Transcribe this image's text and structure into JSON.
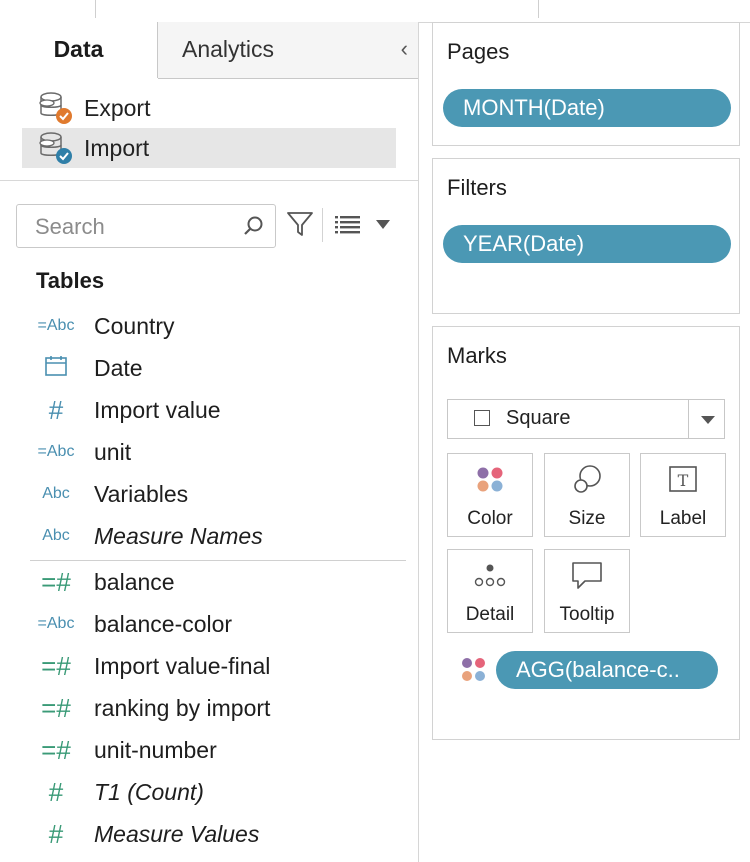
{
  "tabs": {
    "data": "Data",
    "analytics": "Analytics",
    "collapse_glyph": "‹"
  },
  "data_sources": [
    {
      "name": "Export",
      "icon": "database-export-icon",
      "badge_color": "#e07a2e",
      "selected": false
    },
    {
      "name": "Import",
      "icon": "database-import-icon",
      "badge_color": "#2f7fa8",
      "selected": true
    }
  ],
  "search": {
    "placeholder": "Search",
    "value": ""
  },
  "tables_header": "Tables",
  "dimensions": [
    {
      "name": "Country",
      "icon": "=Abc",
      "icon_name": "calculated-string-icon",
      "italic": false
    },
    {
      "name": "Date",
      "icon": "calendar",
      "icon_name": "calendar-icon",
      "italic": false
    },
    {
      "name": "Import value",
      "icon": "#",
      "icon_name": "number-icon",
      "italic": false
    },
    {
      "name": "unit",
      "icon": "=Abc",
      "icon_name": "calculated-string-icon",
      "italic": false
    },
    {
      "name": "Variables",
      "icon": "Abc",
      "icon_name": "string-icon",
      "italic": false
    },
    {
      "name": "Measure Names",
      "icon": "Abc",
      "icon_name": "string-icon",
      "italic": true
    }
  ],
  "measures": [
    {
      "name": "balance",
      "icon": "=#",
      "icon_name": "calculated-number-icon",
      "italic": false
    },
    {
      "name": "balance-color",
      "icon": "=Abc",
      "icon_name": "calculated-string-icon",
      "italic": false
    },
    {
      "name": "Import value-final",
      "icon": "=#",
      "icon_name": "calculated-number-icon",
      "italic": false
    },
    {
      "name": "ranking by import",
      "icon": "=#",
      "icon_name": "calculated-number-icon",
      "italic": false
    },
    {
      "name": "unit-number",
      "icon": "=#",
      "icon_name": "calculated-number-icon",
      "italic": false
    },
    {
      "name": "T1 (Count)",
      "icon": "#",
      "icon_name": "number-icon",
      "italic": true
    },
    {
      "name": "Measure Values",
      "icon": "#",
      "icon_name": "number-icon",
      "italic": true
    }
  ],
  "pages": {
    "title": "Pages",
    "pill": "MONTH(Date)"
  },
  "filters": {
    "title": "Filters",
    "pill": "YEAR(Date)"
  },
  "marks": {
    "title": "Marks",
    "mark_type": "Square",
    "buttons": [
      {
        "label": "Color",
        "icon": "color-dots-icon"
      },
      {
        "label": "Size",
        "icon": "size-circles-icon"
      },
      {
        "label": "Label",
        "icon": "label-t-icon"
      },
      {
        "label": "Detail",
        "icon": "detail-dots-icon"
      },
      {
        "label": "Tooltip",
        "icon": "tooltip-bubble-icon"
      }
    ],
    "color_pill": "AGG(balance-c.."
  },
  "colors": {
    "pill": "#4b98b4",
    "dimension_icon": "#4a8fb0",
    "measure_icon": "#3a9a77",
    "color_dots": [
      "#8e6fa8",
      "#e5647a",
      "#e9a27c",
      "#8bb1d6"
    ]
  }
}
